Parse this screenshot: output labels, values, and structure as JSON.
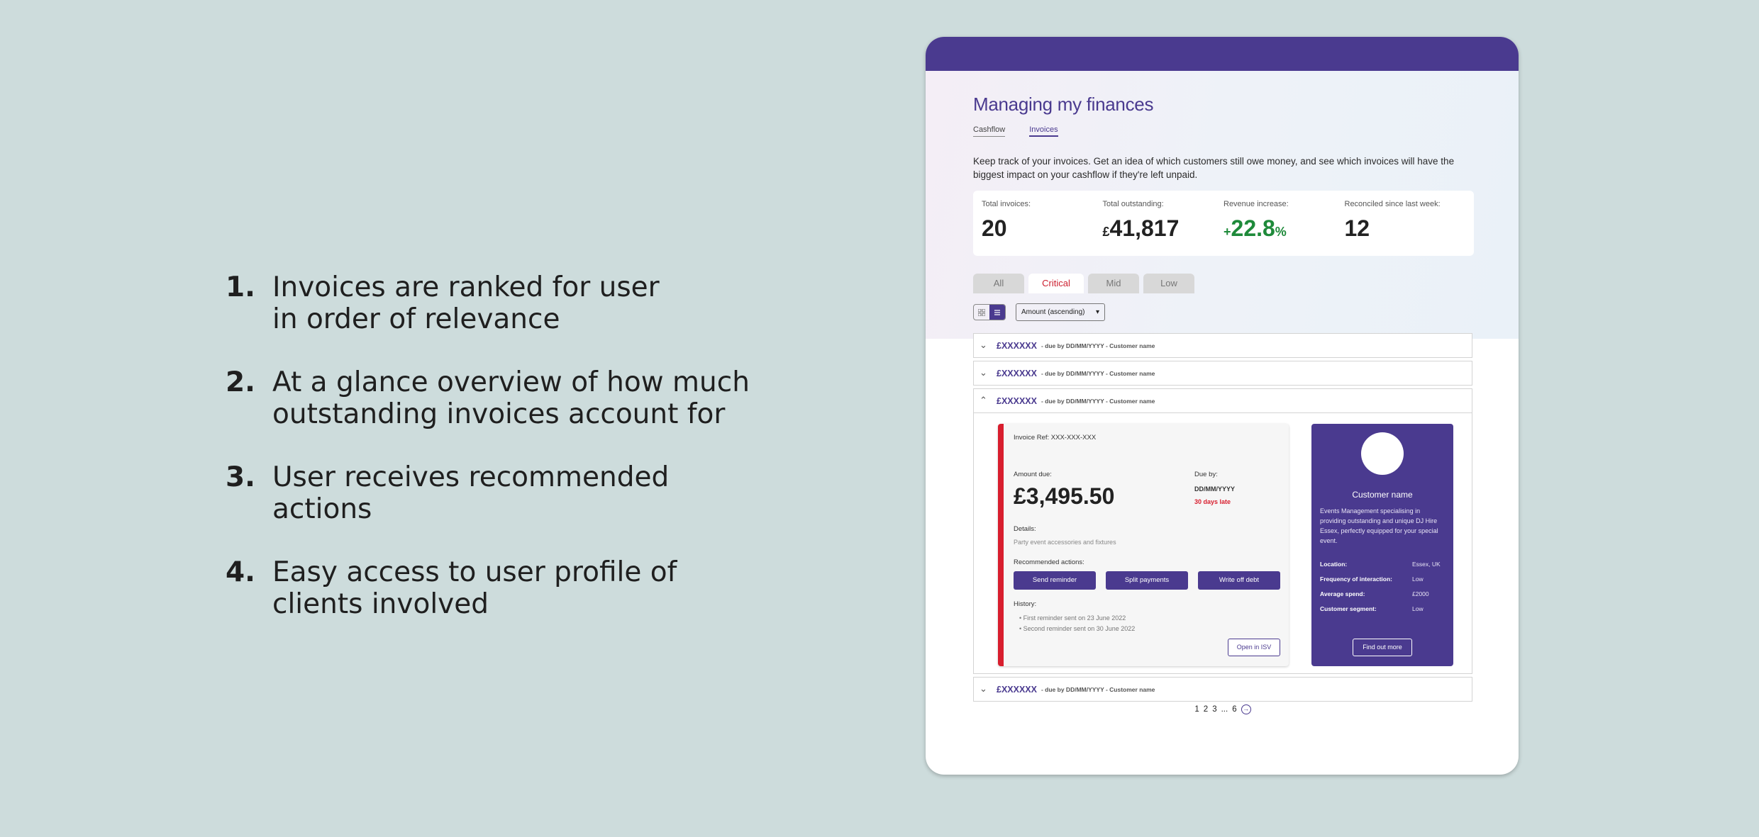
{
  "notes": [
    {
      "num": "1.",
      "text": "Invoices are ranked for user\nin order of relevance"
    },
    {
      "num": "2.",
      "text": "At a glance overview of how much\noutstanding invoices account for"
    },
    {
      "num": "3.",
      "text": "User receives recommended\nactions"
    },
    {
      "num": "4.",
      "text": "Easy access to user profile of\nclients involved"
    }
  ],
  "app": {
    "title": "Managing my finances",
    "tabs": [
      {
        "label": "Cashflow"
      },
      {
        "label": "Invoices"
      }
    ],
    "description": "Keep track of your invoices. Get an idea of which customers still owe money, and see which invoices will have the biggest impact on your cashflow if they're left unpaid.",
    "stats": [
      {
        "label": "Total invoices:",
        "value": "20"
      },
      {
        "label": "Total outstanding:",
        "prefix": "£",
        "value": "41,817"
      },
      {
        "label": "Revenue increase:",
        "prefix": "+",
        "value": "22.8",
        "suffix": "%"
      },
      {
        "label": "Reconciled  since last week:",
        "value": "12"
      }
    ],
    "filters": [
      {
        "label": "All"
      },
      {
        "label": "Critical"
      },
      {
        "label": "Mid"
      },
      {
        "label": "Low"
      }
    ],
    "sort_value": "Amount (ascending)",
    "rows": [
      {
        "amount": "£XXXXXX",
        "meta": "- due by DD/MM/YYYY - Customer name"
      },
      {
        "amount": "£XXXXXX",
        "meta": "- due by DD/MM/YYYY - Customer name"
      },
      {
        "amount": "£XXXXXX",
        "meta": "- due by DD/MM/YYYY - Customer name"
      },
      {
        "amount": "£XXXXXX",
        "meta": "- due by DD/MM/YYYY - Customer name"
      }
    ],
    "invoice": {
      "ref": "Invoice Ref: XXX-XXX-XXX",
      "amount_label": "Amount due:",
      "amount": "£3,495.50",
      "due_label": "Due by:",
      "due_date": "DD/MM/YYYY",
      "late": "30 days late",
      "details_label": "Details:",
      "details": "Party event accessories and fixtures",
      "rec_label": "Recommended actions:",
      "actions": [
        "Send reminder",
        "Split payments",
        "Write off debt"
      ],
      "history_label": "History:",
      "history": [
        "First reminder sent on 23 June 2022",
        "Second reminder sent on 30 June 2022"
      ],
      "open_label": "Open in ISV"
    },
    "customer": {
      "name": "Customer name",
      "description": "Events Management specialising in providing outstanding and unique DJ Hire Essex, perfectly equipped for your special event.",
      "fields": [
        {
          "k": "Location:",
          "v": "Essex, UK"
        },
        {
          "k": "Frequency of interaction:",
          "v": "Low"
        },
        {
          "k": "Average spend:",
          "v": "£2000"
        },
        {
          "k": "Customer segment:",
          "v": "Low"
        }
      ],
      "button": "Find out more"
    },
    "pager": {
      "pages": [
        "1",
        "2",
        "3",
        "...",
        "6"
      ],
      "next_icon": "arrow-right-circle-icon"
    }
  }
}
